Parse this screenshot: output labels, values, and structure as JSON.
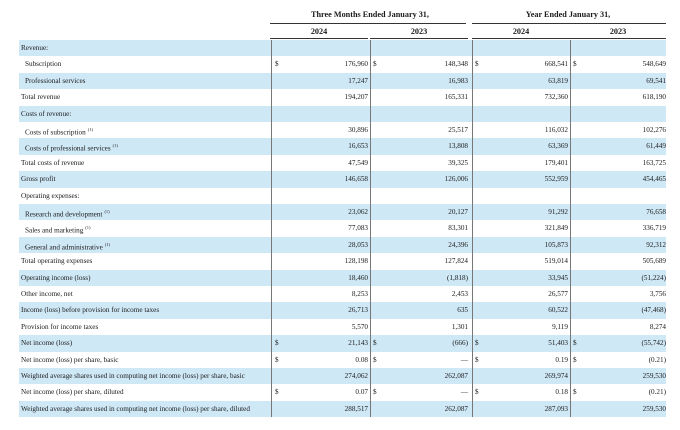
{
  "header": {
    "group_quarter": "Three Months Ended January 31,",
    "group_year": "Year Ended January 31,",
    "years": [
      "2024",
      "2023",
      "2024",
      "2023"
    ]
  },
  "rows": [
    {
      "label": "Revenue:",
      "indent": 0,
      "shade": true,
      "cells": [
        "",
        "",
        "",
        ""
      ]
    },
    {
      "label": "Subscription",
      "indent": 1,
      "shade": false,
      "cells": [
        "176,960",
        "148,348",
        "668,541",
        "548,649"
      ],
      "dollar": [
        true,
        true,
        true,
        true
      ]
    },
    {
      "label": "Professional services",
      "indent": 1,
      "shade": true,
      "cells": [
        "17,247",
        "16,983",
        "63,819",
        "69,541"
      ]
    },
    {
      "label": "Total revenue",
      "indent": 0,
      "shade": false,
      "cells": [
        "194,207",
        "165,331",
        "732,360",
        "618,190"
      ]
    },
    {
      "label": "Costs of revenue:",
      "indent": 0,
      "shade": true,
      "cells": [
        "",
        "",
        "",
        ""
      ]
    },
    {
      "label": "Costs of subscription",
      "fn": "(1)",
      "indent": 1,
      "shade": false,
      "cells": [
        "30,896",
        "25,517",
        "116,032",
        "102,276"
      ]
    },
    {
      "label": "Costs of professional services",
      "fn": "(1)",
      "indent": 1,
      "shade": true,
      "cells": [
        "16,653",
        "13,808",
        "63,369",
        "61,449"
      ]
    },
    {
      "label": "Total costs of revenue",
      "indent": 0,
      "shade": false,
      "cells": [
        "47,549",
        "39,325",
        "179,401",
        "163,725"
      ]
    },
    {
      "label": "Gross profit",
      "indent": 0,
      "shade": true,
      "cells": [
        "146,658",
        "126,006",
        "552,959",
        "454,465"
      ]
    },
    {
      "label": "Operating expenses:",
      "indent": 0,
      "shade": false,
      "cells": [
        "",
        "",
        "",
        ""
      ]
    },
    {
      "label": "Research and development",
      "fn": "(1)",
      "indent": 1,
      "shade": true,
      "cells": [
        "23,062",
        "20,127",
        "91,292",
        "76,658"
      ]
    },
    {
      "label": "Sales and marketing",
      "fn": "(1)",
      "indent": 1,
      "shade": false,
      "cells": [
        "77,083",
        "83,301",
        "321,849",
        "336,719"
      ]
    },
    {
      "label": "General and administrative",
      "fn": "(1)",
      "indent": 1,
      "shade": true,
      "cells": [
        "28,053",
        "24,396",
        "105,873",
        "92,312"
      ]
    },
    {
      "label": "Total operating expenses",
      "indent": 0,
      "shade": false,
      "cells": [
        "128,198",
        "127,824",
        "519,014",
        "505,689"
      ]
    },
    {
      "label": "Operating income (loss)",
      "indent": 0,
      "shade": true,
      "cells": [
        "18,460",
        "(1,818)",
        "33,945",
        "(51,224)"
      ]
    },
    {
      "label": "Other income, net",
      "indent": 0,
      "shade": false,
      "cells": [
        "8,253",
        "2,453",
        "26,577",
        "3,756"
      ]
    },
    {
      "label": "Income (loss) before provision for income taxes",
      "indent": 0,
      "shade": true,
      "cells": [
        "26,713",
        "635",
        "60,522",
        "(47,468)"
      ]
    },
    {
      "label": "Provision for income taxes",
      "indent": 0,
      "shade": false,
      "cells": [
        "5,570",
        "1,301",
        "9,119",
        "8,274"
      ]
    },
    {
      "label": "Net income (loss)",
      "indent": 0,
      "shade": true,
      "cells": [
        "21,143",
        "(666)",
        "51,403",
        "(55,742)"
      ],
      "dollar": [
        true,
        true,
        true,
        true
      ]
    },
    {
      "label": "Net income (loss) per share, basic",
      "indent": 0,
      "shade": false,
      "cells": [
        "0.08",
        "—",
        "0.19",
        "(0.21)"
      ],
      "dollar": [
        true,
        true,
        true,
        true
      ]
    },
    {
      "label": "Weighted average shares used in computing net income (loss) per share, basic",
      "indent": 0,
      "shade": true,
      "cells": [
        "274,062",
        "262,087",
        "269,974",
        "259,530"
      ]
    },
    {
      "label": "Net income (loss) per share, diluted",
      "indent": 0,
      "shade": false,
      "cells": [
        "0.07",
        "—",
        "0.18",
        "(0.21)"
      ],
      "dollar": [
        true,
        true,
        true,
        true
      ]
    },
    {
      "label": "Weighted average shares used in computing net income (loss) per share, diluted",
      "indent": 0,
      "shade": true,
      "cells": [
        "288,517",
        "262,087",
        "287,093",
        "259,530"
      ]
    }
  ]
}
